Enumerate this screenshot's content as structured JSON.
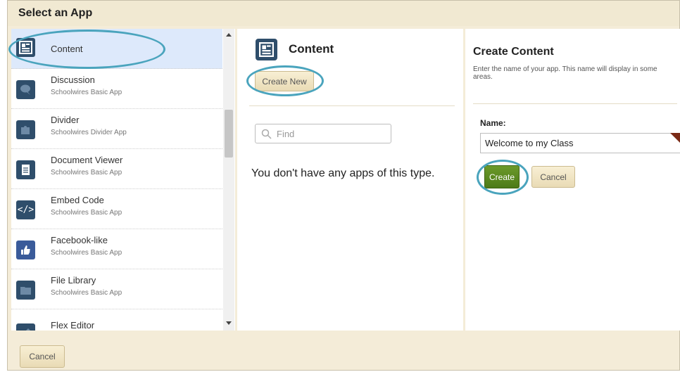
{
  "dialog": {
    "title": "Select an App",
    "cancel_label": "Cancel"
  },
  "app_list": {
    "items": [
      {
        "name": "Content",
        "subtitle": "",
        "icon": "content-layout-icon",
        "selected": true
      },
      {
        "name": "Discussion",
        "subtitle": "Schoolwires Basic App",
        "icon": "discussion-bubble-icon"
      },
      {
        "name": "Divider",
        "subtitle": "Schoolwires Divider App",
        "icon": "puzzle-piece-icon"
      },
      {
        "name": "Document Viewer",
        "subtitle": "Schoolwires Basic App",
        "icon": "document-icon"
      },
      {
        "name": "Embed Code",
        "subtitle": "Schoolwires Basic App",
        "icon": "code-brackets-icon"
      },
      {
        "name": "Facebook-like",
        "subtitle": "Schoolwires Basic App",
        "icon": "thumbs-up-icon"
      },
      {
        "name": "File Library",
        "subtitle": "Schoolwires Basic App",
        "icon": "folder-icon"
      },
      {
        "name": "Flex Editor",
        "subtitle": "",
        "icon": "pencil-icon"
      }
    ]
  },
  "middle": {
    "title": "Content",
    "create_new_label": "Create New",
    "find_placeholder": "Find",
    "empty_message": "You don't have any apps of this type."
  },
  "right": {
    "title": "Create Content",
    "description": "Enter the name of your app. This name will display in some areas.",
    "name_label": "Name:",
    "name_value": "Welcome to my Class",
    "create_label": "Create",
    "cancel_label": "Cancel"
  },
  "colors": {
    "highlight_oval": "#4aa4bd",
    "create_button": "#5a8a22",
    "icon_bg": "#2f4e6b",
    "selected_row": "#dde9fb"
  }
}
